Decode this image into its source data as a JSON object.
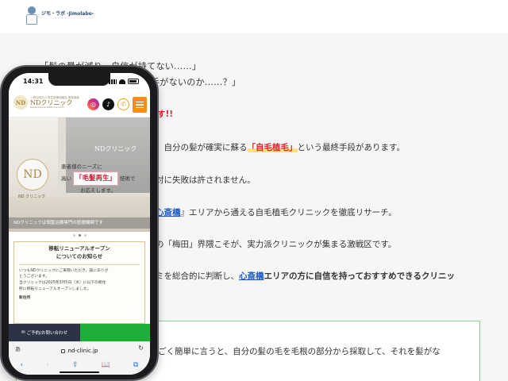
{
  "site": {
    "logo_title": "ジモ・ラボ -Jimolabo-",
    "logo_subtitle": "・・・・・・・"
  },
  "article": {
    "quote_1": "「髪の量が減り、自信が持てない......」",
    "quote_2": "手がないのか......？」",
    "red_tail": "す!!",
    "p1_prefix": "、自分の髪が確実に蘇る",
    "p1_highlight": "「自毛植毛」",
    "p1_suffix": "という最終手段があります。",
    "p2": "対に失敗は許されません。",
    "p3_link": "心斎橋",
    "p3_suffix": "』エリアから通える自毛植毛クリニックを徹底リサーチ。",
    "p4": "の「梅田」界隈こそが、実力派クリニックが集まる激戦区です。",
    "p5_prefix": "ミを総合的に判断し、",
    "p5_link": "心斎橋",
    "p5_bold": "エリアの方に",
    "p5_suffix": "自信を持っておすすめできるクリニッ",
    "p6": "ごく簡単に言うと、自分の髪の毛を毛根の部分から採取して、それを髪がな"
  },
  "phone": {
    "status_time": "14:31",
    "clinic": {
      "caption": "一般社団法人 再生医療協議会 推奨施設",
      "name": "NDクリニック",
      "name_en": "Regenerative Medicine Clinic",
      "mark": "ND"
    },
    "hero": {
      "sign": "NDクリニック",
      "logo": "ND",
      "logo_label": "ND クリニック",
      "line1": "患者様のニーズに",
      "line2_pre": "高い",
      "line2_emph": "「毛髪再生」",
      "line2_post": "技術で",
      "line3": "お応えします。",
      "strap": "NDクリニックは頭髪治療専門の医療機関です"
    },
    "notice": {
      "title_1": "移転リニューアルオープン",
      "title_2": "についてのお知らせ",
      "body_1": "いつもNDクリニックにご来院いただき、誠にありが",
      "body_2": "とうございます。",
      "body_3": "当クリニックは2025年3月5日（水）に以下の新住",
      "body_4": "所に移転リニューアルオープンしました。",
      "body_5": "新住所"
    },
    "cta": {
      "reserve_label": "ご予約/お問い合わせ"
    },
    "browser": {
      "aa": "あ",
      "url": "nd-clinic.jp",
      "reload": "↻",
      "back": "‹",
      "forward": "›",
      "share": "⇪",
      "bookmarks": "📖",
      "tabs": "⧉"
    }
  }
}
